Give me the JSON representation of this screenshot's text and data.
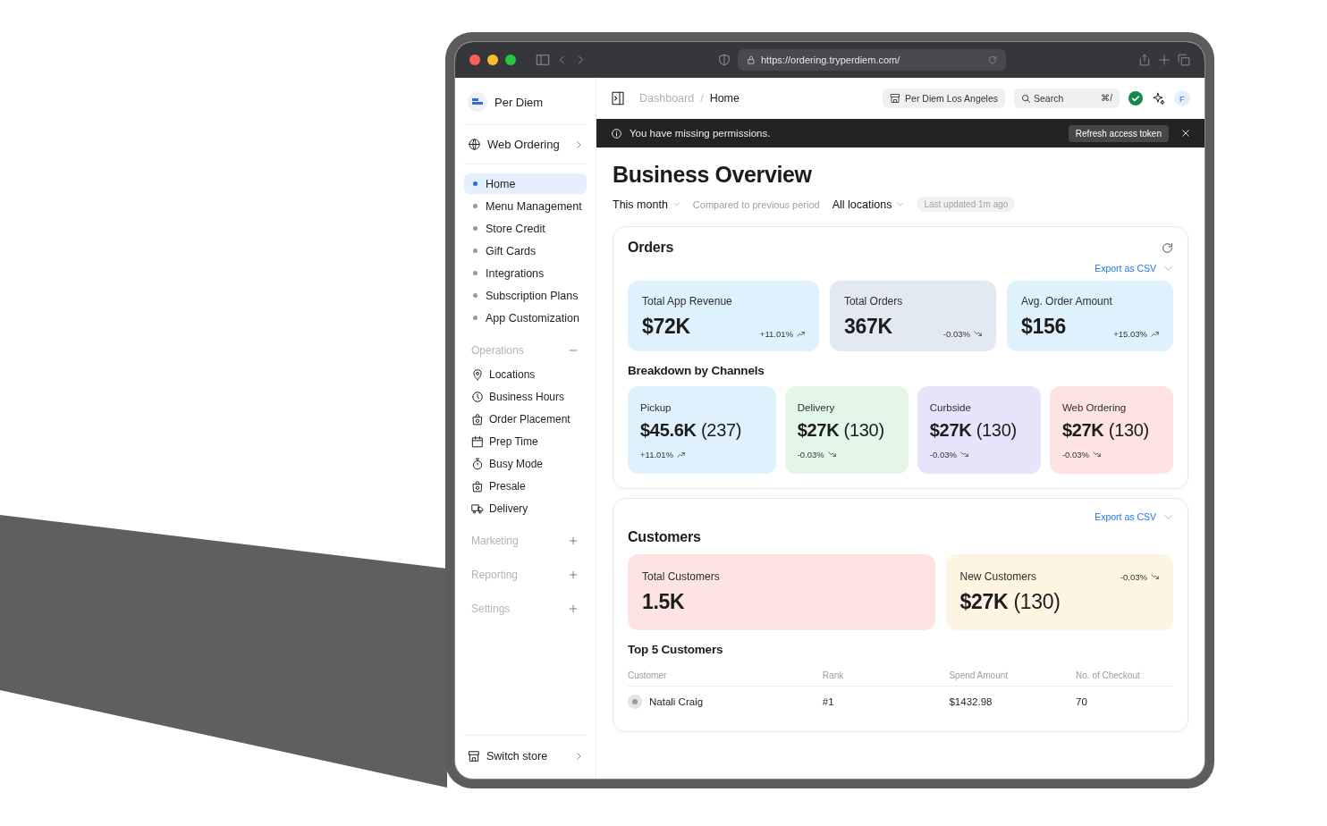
{
  "browser": {
    "url": "https://ordering.tryperdiem.com/"
  },
  "sidebar": {
    "brand": "Per Diem",
    "workspace": "Web Ordering",
    "items": [
      {
        "label": "Home",
        "selected": true
      },
      {
        "label": "Menu Management",
        "selected": false
      },
      {
        "label": "Store Credit",
        "selected": false
      },
      {
        "label": "Gift Cards",
        "selected": false
      },
      {
        "label": "Integrations",
        "selected": false
      },
      {
        "label": "Subscription Plans",
        "selected": false
      },
      {
        "label": "App Customization",
        "selected": false
      }
    ],
    "sections": [
      {
        "title": "Operations",
        "expanded": true,
        "items": [
          "Locations",
          "Business Hours",
          "Order Placement",
          "Prep Time",
          "Busy Mode",
          "Presale",
          "Delivery"
        ]
      },
      {
        "title": "Marketing",
        "expanded": false
      },
      {
        "title": "Reporting",
        "expanded": false
      },
      {
        "title": "Settings",
        "expanded": false
      }
    ],
    "footer": "Switch store"
  },
  "header": {
    "breadcrumb": [
      "Dashboard",
      "Home"
    ],
    "separator": "/",
    "store": "Per Diem Los Angeles",
    "search": {
      "placeholder": "Search",
      "shortcut": "⌘/"
    },
    "avatar": "F"
  },
  "banner": {
    "message": "You have missing permissions.",
    "action": "Refresh access token"
  },
  "overview": {
    "title": "Business Overview",
    "filters": [
      {
        "kind": "dropdown",
        "label": "This month"
      },
      {
        "kind": "note",
        "label": "Compared to previous period"
      },
      {
        "kind": "dropdown",
        "label": "All locations"
      },
      {
        "kind": "tag",
        "label": "Last updated 1m ago"
      }
    ]
  },
  "orders": {
    "title": "Orders",
    "export": "Export as CSV",
    "metrics": [
      {
        "label": "Total App Revenue",
        "value": "$72K",
        "change": "+11.01%",
        "kind": "up",
        "color": "#dff1fc"
      },
      {
        "label": "Total Orders",
        "value": "367K",
        "change": "-0.03%",
        "kind": "down",
        "color": "#e3e9f3"
      },
      {
        "label": "Avg. Order Amount",
        "value": "$156",
        "change": "+15.03%",
        "kind": "up",
        "color": "#dff1fc"
      }
    ],
    "breakdown_title": "Breakdown by Channels",
    "channels": [
      {
        "label": "Pickup",
        "value": "**$45.6K** (237)",
        "change": "+11.01%",
        "kind": "up",
        "color": "#dff1fc"
      },
      {
        "label": "Delivery",
        "value": "**$27K** (130)",
        "change": "-0.03%",
        "kind": "down",
        "color": "#e4f6e8"
      },
      {
        "label": "Curbside",
        "value": "**$27K** (130)",
        "change": "-0.03%",
        "kind": "down",
        "color": "#e9e2fb"
      },
      {
        "label": "Web Ordering",
        "value": "**$27K** (130)",
        "change": "-0.03%",
        "kind": "down",
        "color": "#fde3e1"
      }
    ]
  },
  "customers": {
    "export": "Export as CSV",
    "title": "Customers",
    "metrics": [
      {
        "label": "Total Customers",
        "value": "1.5K",
        "color": "#fde3e1"
      },
      {
        "label": "New Customers",
        "value": "**$27K** (130)",
        "change": "-0.03%",
        "kind": "down",
        "color": "#fdf4e1"
      }
    ],
    "top_title": "Top 5 Customers",
    "table": {
      "columns": [
        "Customer",
        "Rank",
        "Spend Amount",
        "No. of Checkout"
      ],
      "rows": [
        [
          "Natali Craig",
          "#1",
          "$1432.98",
          "70"
        ]
      ]
    }
  }
}
